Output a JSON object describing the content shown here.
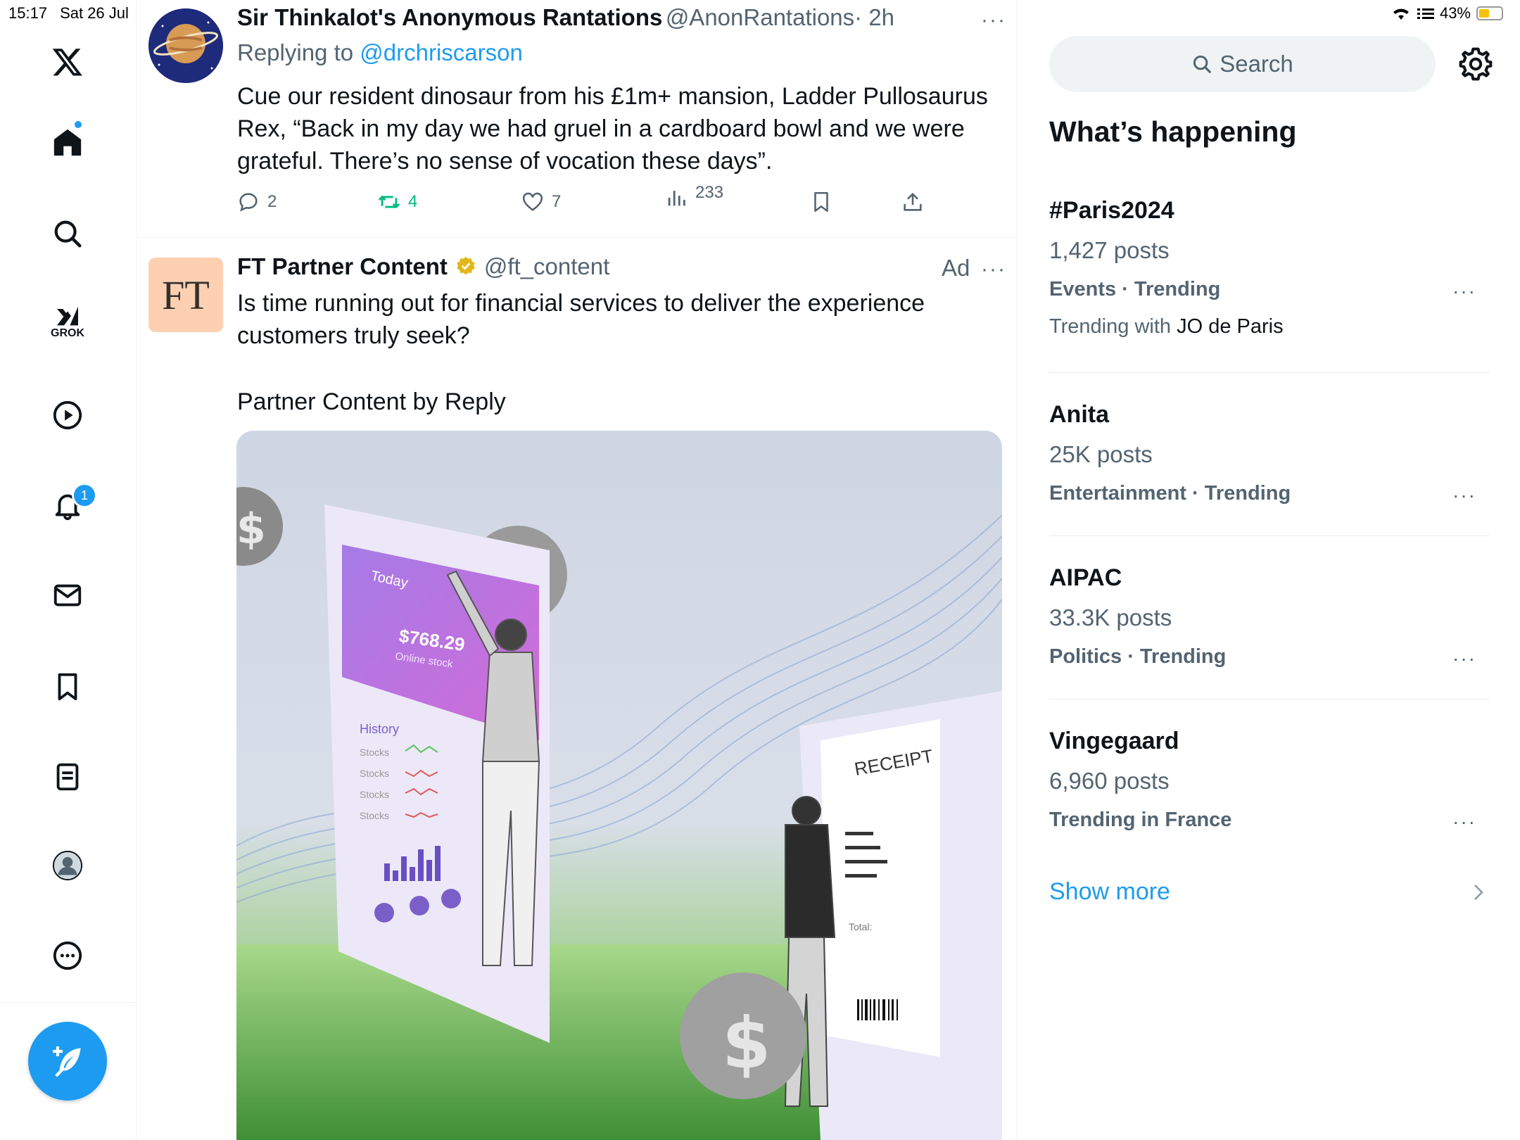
{
  "status_bar": {
    "time": "15:17",
    "date": "Sat 26 Jul",
    "battery": "43%",
    "battery_level": 0.43
  },
  "nav": {
    "items": [
      "x-logo",
      "home",
      "explore",
      "grok",
      "videos",
      "notifications",
      "messages",
      "bookmarks",
      "lists",
      "profile",
      "more"
    ],
    "grok_label": "GROK",
    "notification_count": "1"
  },
  "tweet1": {
    "name": "Sir Thinkalot's Anonymous Rantations",
    "handle": "@AnonRantations",
    "time": "· 2h",
    "replying_prefix": "Replying to",
    "replying_to": "@drchriscarson",
    "text": "Cue our resident dinosaur from his £1m+ mansion, Ladder Pullosaurus Rex, “Back in my day we had gruel in a cardboard bowl and we were grateful. There’s no sense of vocation these days”.",
    "replies": "2",
    "reposts": "4",
    "likes": "7",
    "views": "233",
    "more": "···"
  },
  "tweet2": {
    "avatar_text": "FT",
    "name": "FT Partner Content",
    "handle": "@ft_content",
    "ad_label": "Ad",
    "more": "···",
    "text1": "Is time running out for financial services to deliver the experience customers truly seek?",
    "text2": "Partner Content by Reply",
    "image": {
      "phone_today": "Today",
      "phone_amount": "$768.29",
      "phone_sub": "Online stock",
      "history": "History",
      "stocks": [
        "Stocks",
        "Stocks",
        "Stocks",
        "Stocks"
      ],
      "receipt_title": "RECEIPT",
      "receipt_total": "Total:",
      "dollar": "$"
    }
  },
  "sidebar": {
    "search_placeholder": "Search",
    "whats_happening": "What’s happening",
    "trends": [
      {
        "title": "#Paris2024",
        "posts": "1,427 posts",
        "meta": "Events · Trending",
        "with_prefix": "Trending with",
        "with_name": "JO de Paris"
      },
      {
        "title": "Anita",
        "posts": "25K posts",
        "meta": "Entertainment · Trending"
      },
      {
        "title": "AIPAC",
        "posts": "33.3K posts",
        "meta": "Politics · Trending"
      },
      {
        "title": "Vingegaard",
        "posts": "6,960 posts",
        "meta": "Trending in France"
      }
    ],
    "trend_more": "···",
    "show_more": "Show more"
  },
  "colors": {
    "accent": "#1d9bf0",
    "repost_green": "#00ba7c",
    "text": "#0f1419",
    "muted": "#536471"
  }
}
